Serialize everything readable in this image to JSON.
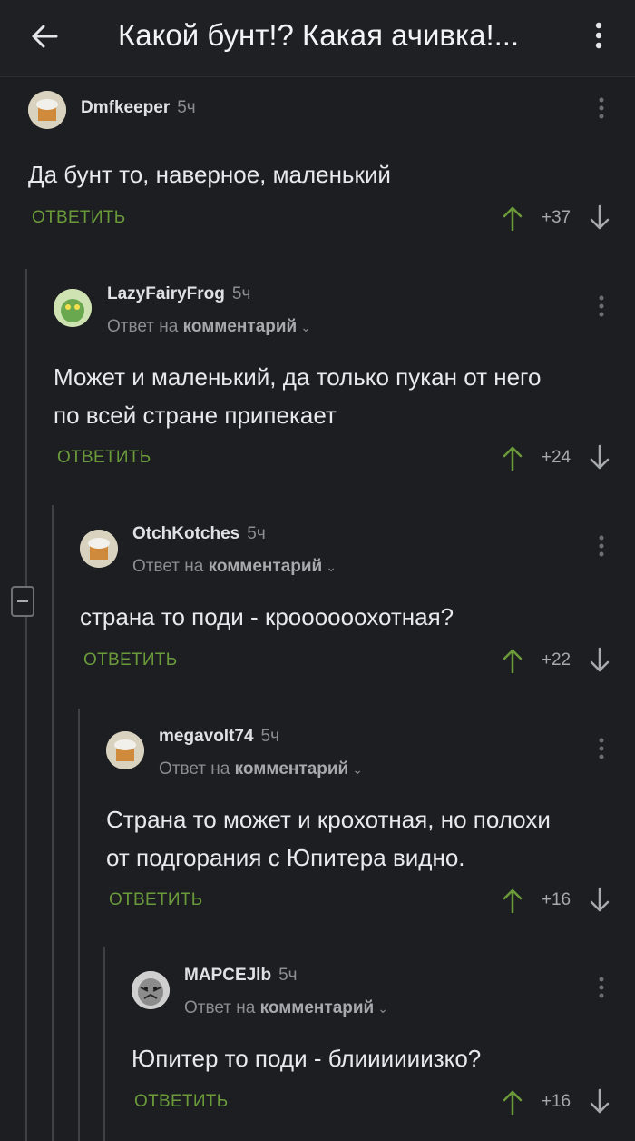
{
  "header": {
    "title": "Какой бунт!? Какая ачивка!..."
  },
  "comments": [
    {
      "user": "Dmfkeeper",
      "time": "5ч",
      "reply_prefix": "",
      "reply_link": "",
      "lines": [
        "Да бунт то, наверное, маленький"
      ],
      "reply_label": "ОТВЕТИТЬ",
      "score": "+37"
    },
    {
      "user": "LazyFairyFrog",
      "time": "5ч",
      "reply_prefix": "Ответ на",
      "reply_link": "комментарий",
      "lines": [
        "Может и маленький, да только пукан от него",
        "по всей стране припекает"
      ],
      "reply_label": "ОТВЕТИТЬ",
      "score": "+24"
    },
    {
      "user": "OtchKotches",
      "time": "5ч",
      "reply_prefix": "Ответ на",
      "reply_link": "комментарий",
      "lines": [
        "страна то поди - кроооооохотная?"
      ],
      "reply_label": "ОТВЕТИТЬ",
      "score": "+22"
    },
    {
      "user": "megavolt74",
      "time": "5ч",
      "reply_prefix": "Ответ на",
      "reply_link": "комментарий",
      "lines": [
        "Страна то может и крохотная, но полохи",
        "от подгорания с Юпитера видно."
      ],
      "reply_label": "ОТВЕТИТЬ",
      "score": "+16"
    },
    {
      "user": "MAPCEJlb",
      "time": "5ч",
      "reply_prefix": "Ответ на",
      "reply_link": "комментарий",
      "lines": [
        "Юпитер то поди - блиииииизко?"
      ],
      "reply_label": "ОТВЕТИТЬ",
      "score": "+16"
    }
  ],
  "colors": {
    "accent": "#6b9a3a",
    "background": "#1c1e21",
    "muted": "#8a8d92"
  },
  "icons": {
    "back": "arrow-left-icon",
    "menu": "kebab-icon",
    "upvote": "arrow-up-icon",
    "downvote": "arrow-down-icon",
    "collapse": "minus-icon"
  }
}
